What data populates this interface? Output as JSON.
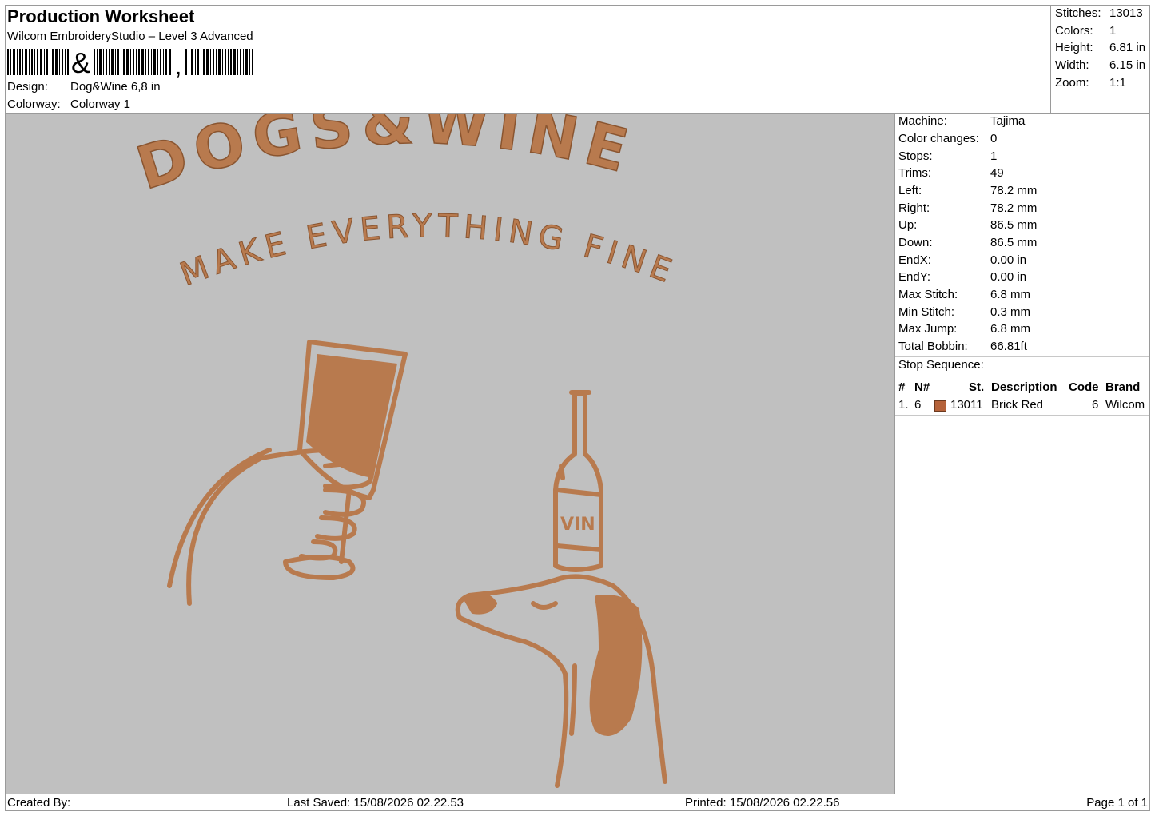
{
  "header": {
    "title": "Production Worksheet",
    "software": "Wilcom EmbroideryStudio – Level 3 Advanced",
    "barcode_text": "Dog&Wine 6,8 in",
    "design_label": "Design:",
    "design_value": "Dog&Wine 6,8 in",
    "colorway_label": "Colorway:",
    "colorway_value": "Colorway 1"
  },
  "stats": [
    {
      "label": "Stitches:",
      "value": "13013"
    },
    {
      "label": "Colors:",
      "value": "1"
    },
    {
      "label": "Height:",
      "value": "6.81 in"
    },
    {
      "label": "Width:",
      "value": "6.15 in"
    },
    {
      "label": "Zoom:",
      "value": "1:1"
    }
  ],
  "machine_info": [
    {
      "label": "Machine:",
      "value": "Tajima"
    },
    {
      "label": "Color changes:",
      "value": "0"
    },
    {
      "label": "Stops:",
      "value": "1"
    },
    {
      "label": "Trims:",
      "value": "49"
    },
    {
      "label": "Left:",
      "value": "78.2 mm"
    },
    {
      "label": "Right:",
      "value": "78.2 mm"
    },
    {
      "label": "Up:",
      "value": "86.5 mm"
    },
    {
      "label": "Down:",
      "value": "86.5 mm"
    },
    {
      "label": "EndX:",
      "value": "0.00 in"
    },
    {
      "label": "EndY:",
      "value": "0.00 in"
    },
    {
      "label": "Max Stitch:",
      "value": "6.8 mm"
    },
    {
      "label": "Min Stitch:",
      "value": "0.3 mm"
    },
    {
      "label": "Max Jump:",
      "value": "6.8 mm"
    },
    {
      "label": "Total Bobbin:",
      "value": "66.81ft"
    }
  ],
  "stop_sequence": {
    "title": "Stop Sequence:",
    "columns": [
      "#",
      "N#",
      "St.",
      "Description",
      "Code",
      "Brand"
    ],
    "rows": [
      {
        "num": "1.",
        "needle": "6",
        "stitches": "13011",
        "description": "Brick Red",
        "code": "6",
        "brand": "Wilcom",
        "color": "#b5623a"
      }
    ]
  },
  "design": {
    "headline": "DOGS&WINE",
    "subline": "MAKE EVERYTHING FINE",
    "bottle_label": "VIN",
    "thread_color": "#b87a4e",
    "background_color": "#c0c0c0"
  },
  "footer": {
    "created_by": "Created By:",
    "last_saved": "Last Saved: 15/08/2026 02.22.53",
    "printed": "Printed: 15/08/2026 02.22.56",
    "page": "Page 1 of 1"
  }
}
